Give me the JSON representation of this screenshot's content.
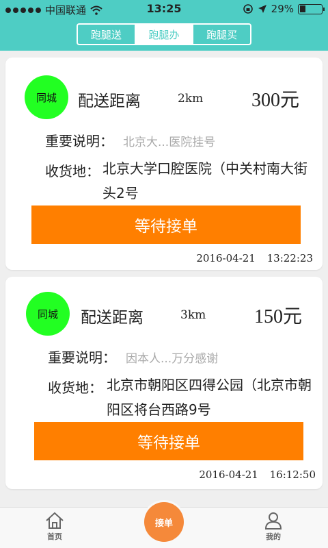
{
  "status_bar": {
    "carrier": "中国联通",
    "time": "13:25",
    "battery": "29%",
    "battery_level": 0.29
  },
  "tabs": [
    {
      "label": "跑腿送",
      "active": false
    },
    {
      "label": "跑腿办",
      "active": true
    },
    {
      "label": "跑腿买",
      "active": false
    }
  ],
  "orders": [
    {
      "badge": "同城",
      "distance_label": "配送距离",
      "distance": "2km",
      "price": "300元",
      "note_label": "重要说明：",
      "note": "北京大...医院挂号",
      "address_label": "收货地：",
      "address": "北京大学口腔医院（中关村南大街头2号",
      "action": "等待接单",
      "date": "2016-04-21",
      "time": "13:22:23"
    },
    {
      "badge": "同城",
      "distance_label": "配送距离",
      "distance": "3km",
      "price": "150元",
      "note_label": "重要说明：",
      "note": "因本人...万分感谢",
      "address_label": "收货地：",
      "address": "北京市朝阳区四得公园（北京市朝阳区将台西路9号",
      "action": "等待接单",
      "date": "2016-04-21",
      "time": "16:12:50"
    }
  ],
  "bottom_nav": {
    "home": "首页",
    "center": "接单",
    "profile": "我的"
  },
  "colors": {
    "header": "#4ecdc4",
    "badge": "#22ff22",
    "action": "#ff7f00",
    "center_button": "#f5893a"
  }
}
